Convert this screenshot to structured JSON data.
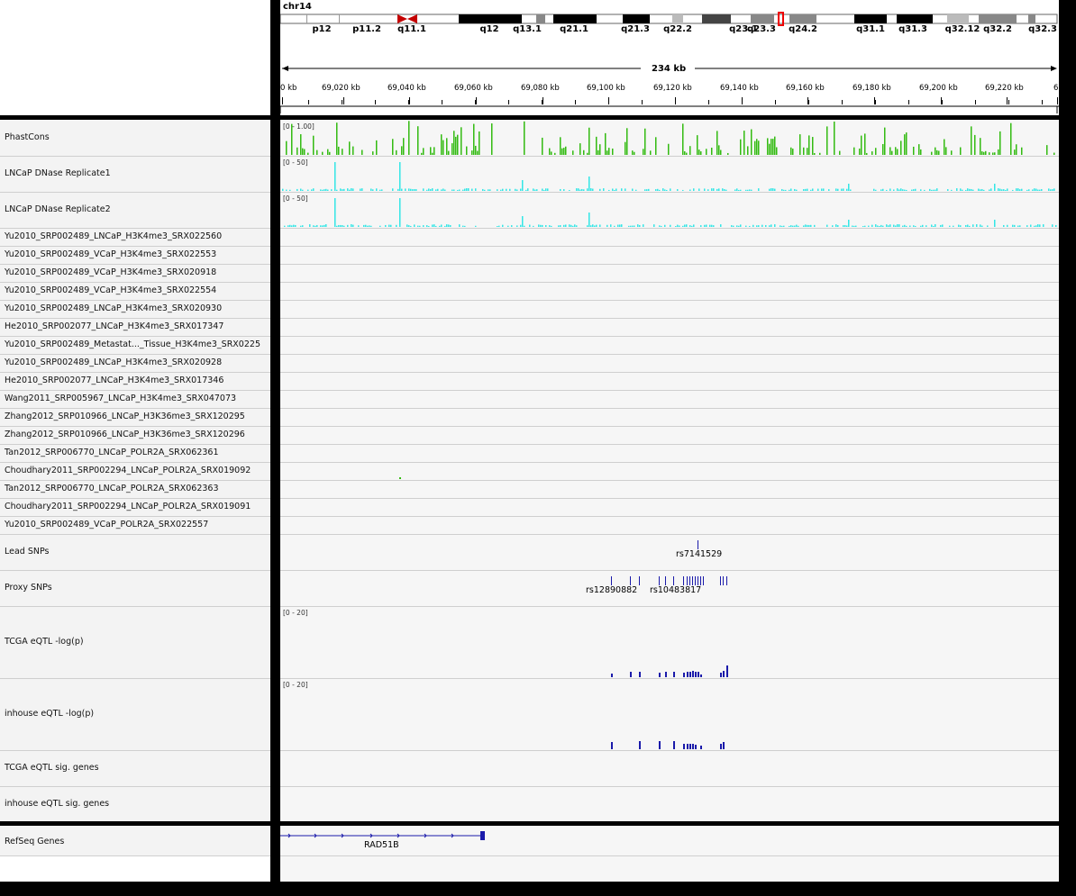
{
  "header": {
    "chromosome": "chr14",
    "span_label": "234 kb",
    "bands": [
      "p12",
      "p11.2",
      "q11.1",
      "q12",
      "q13.1",
      "q21.1",
      "q21.3",
      "q22.2",
      "q23.1",
      "q23.3",
      "q24.2",
      "q31.1",
      "q31.3",
      "q32.12",
      "q32.2",
      "q32.3"
    ],
    "ruler_ticks": [
      "0 kb",
      "69,020 kb",
      "69,040 kb",
      "69,060 kb",
      "69,080 kb",
      "69,100 kb",
      "69,120 kb",
      "69,140 kb",
      "69,160 kb",
      "69,180 kb",
      "69,200 kb",
      "69,220 kb",
      "6"
    ]
  },
  "tracks": [
    {
      "id": "phastcons",
      "name": "PhastCons",
      "range": "[0 - 1.00]",
      "type": "bar",
      "color": "#33bb11"
    },
    {
      "id": "dnase1",
      "name": "LNCaP DNase Replicate1",
      "range": "[0 - 50]",
      "type": "bar",
      "color": "#33e6e6"
    },
    {
      "id": "dnase2",
      "name": "LNCaP DNase Replicate2",
      "range": "[0 - 50]",
      "type": "bar",
      "color": "#33e6e6"
    },
    {
      "id": "chip1",
      "name": "Yu2010_SRP002489_LNCaP_H3K4me3_SRX022560"
    },
    {
      "id": "chip2",
      "name": "Yu2010_SRP002489_VCaP_H3K4me3_SRX022553"
    },
    {
      "id": "chip3",
      "name": "Yu2010_SRP002489_VCaP_H3K4me3_SRX020918"
    },
    {
      "id": "chip4",
      "name": "Yu2010_SRP002489_VCaP_H3K4me3_SRX022554"
    },
    {
      "id": "chip5",
      "name": "Yu2010_SRP002489_LNCaP_H3K4me3_SRX020930"
    },
    {
      "id": "chip6",
      "name": "He2010_SRP002077_LNCaP_H3K4me3_SRX017347"
    },
    {
      "id": "chip7",
      "name": "Yu2010_SRP002489_Metastat..._Tissue_H3K4me3_SRX0225"
    },
    {
      "id": "chip8",
      "name": "Yu2010_SRP002489_LNCaP_H3K4me3_SRX020928"
    },
    {
      "id": "chip9",
      "name": "He2010_SRP002077_LNCaP_H3K4me3_SRX017346"
    },
    {
      "id": "chip10",
      "name": "Wang2011_SRP005967_LNCaP_H3K4me3_SRX047073"
    },
    {
      "id": "chip11",
      "name": "Zhang2012_SRP010966_LNCaP_H3K36me3_SRX120295"
    },
    {
      "id": "chip12",
      "name": "Zhang2012_SRP010966_LNCaP_H3K36me3_SRX120296"
    },
    {
      "id": "chip13",
      "name": "Tan2012_SRP006770_LNCaP_POLR2A_SRX062361"
    },
    {
      "id": "chip14",
      "name": "Choudhary2011_SRP002294_LNCaP_POLR2A_SRX019092"
    },
    {
      "id": "chip15",
      "name": "Tan2012_SRP006770_LNCaP_POLR2A_SRX062363"
    },
    {
      "id": "chip16",
      "name": "Choudhary2011_SRP002294_LNCaP_POLR2A_SRX019091"
    },
    {
      "id": "chip17",
      "name": "Yu2010_SRP002489_VCaP_POLR2A_SRX022557"
    },
    {
      "id": "lead",
      "name": "Lead SNPs",
      "snp_label": "rs7141529"
    },
    {
      "id": "proxy",
      "name": "Proxy SNPs",
      "snp_labels": [
        "rs12890882",
        "rs10483817"
      ]
    },
    {
      "id": "tcga",
      "name": "TCGA eQTL -log(p)",
      "range": "[0 - 20]"
    },
    {
      "id": "inhouse",
      "name": "inhouse eQTL -log(p)",
      "range": "[0 - 20]"
    },
    {
      "id": "tcgasig",
      "name": "TCGA eQTL sig. genes"
    },
    {
      "id": "inhousesig",
      "name": "inhouse eQTL sig. genes"
    }
  ],
  "gene_track": {
    "name": "RefSeq Genes",
    "gene": "RAD51B",
    "color": "#1a1aaa"
  }
}
